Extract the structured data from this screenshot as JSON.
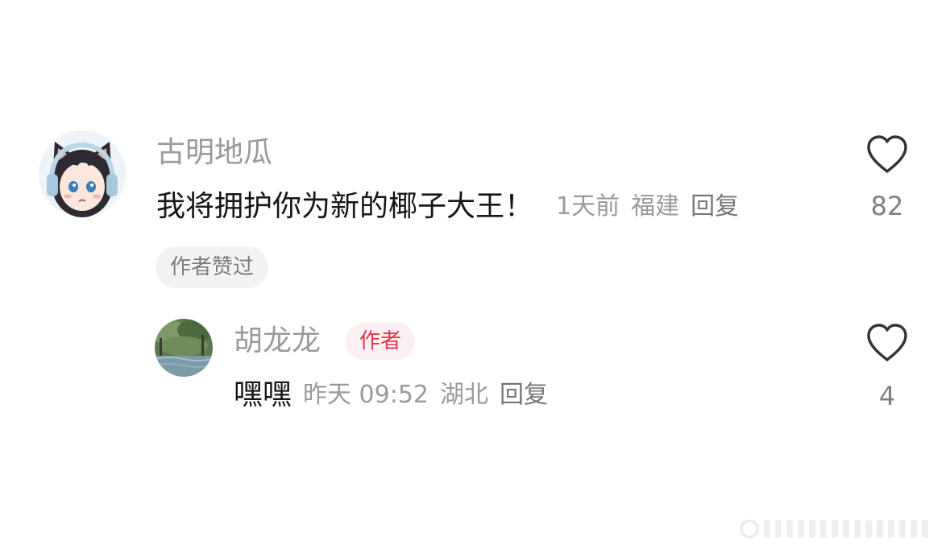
{
  "comments": [
    {
      "username": "古明地瓜",
      "avatar_icon": "anime-girl-avatar-icon",
      "content": "我将拥护你为新的椰子大王！",
      "time": "1天前",
      "location": "福建",
      "reply_label": "回复",
      "author_liked_tag": "作者赞过",
      "like_count": "82",
      "like_icon": "heart-outline-icon"
    }
  ],
  "replies": [
    {
      "username": "胡龙龙",
      "badge": "作者",
      "avatar_icon": "garden-pond-avatar-icon",
      "content": "嘿嘿",
      "time": "昨天 09:52",
      "location": "湖北",
      "reply_label": "回复",
      "like_count": "4",
      "like_icon": "heart-outline-icon"
    }
  ],
  "colors": {
    "background": "#ffffff",
    "username": "#9a9a9a",
    "content": "#161616",
    "meta": "#9a9a9a",
    "badge_text": "#e8334a",
    "badge_bg": "#fdf0f2",
    "tag_bg": "#f3f3f3",
    "heart_stroke": "#333333"
  }
}
